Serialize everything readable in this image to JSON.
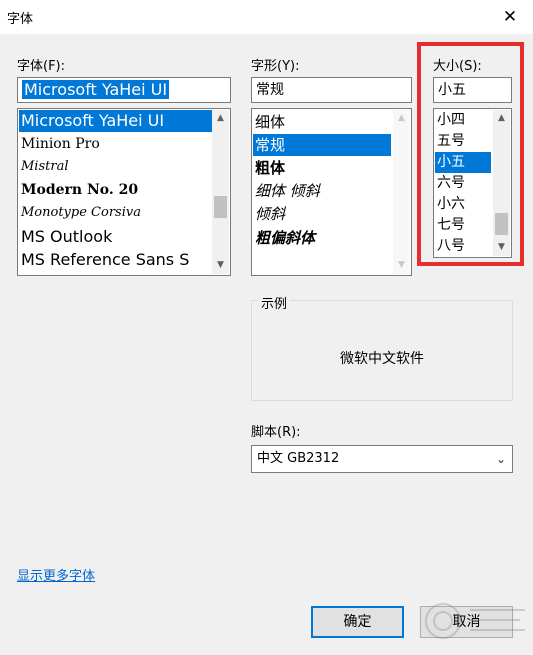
{
  "title": "字体",
  "close_glyph": "✕",
  "font": {
    "label": "字体(F):",
    "value": "Microsoft YaHei UI",
    "items": [
      "Microsoft YaHei UI",
      "Minion Pro",
      "Mistral",
      "Modern No. 20",
      "Monotype Corsiva",
      "MS Outlook",
      "MS Reference Sans S"
    ],
    "selected_index": 0
  },
  "style": {
    "label": "字形(Y):",
    "value": "常规",
    "items": [
      "细体",
      "常规",
      "粗体",
      "细体 倾斜",
      "倾斜",
      "粗偏斜体"
    ],
    "selected_index": 1
  },
  "size": {
    "label": "大小(S):",
    "value": "小五",
    "items": [
      "小四",
      "五号",
      "小五",
      "六号",
      "小六",
      "七号",
      "八号"
    ],
    "selected_index": 2
  },
  "sample": {
    "label": "示例",
    "text": "微软中文软件"
  },
  "script": {
    "label": "脚本(R):",
    "value": "中文 GB2312"
  },
  "more_fonts_link": "显示更多字体",
  "buttons": {
    "ok": "确定",
    "cancel": "取消"
  },
  "colors": {
    "selection": "#0078d7",
    "highlight_frame": "#e62e2e",
    "link": "#0066cc"
  }
}
